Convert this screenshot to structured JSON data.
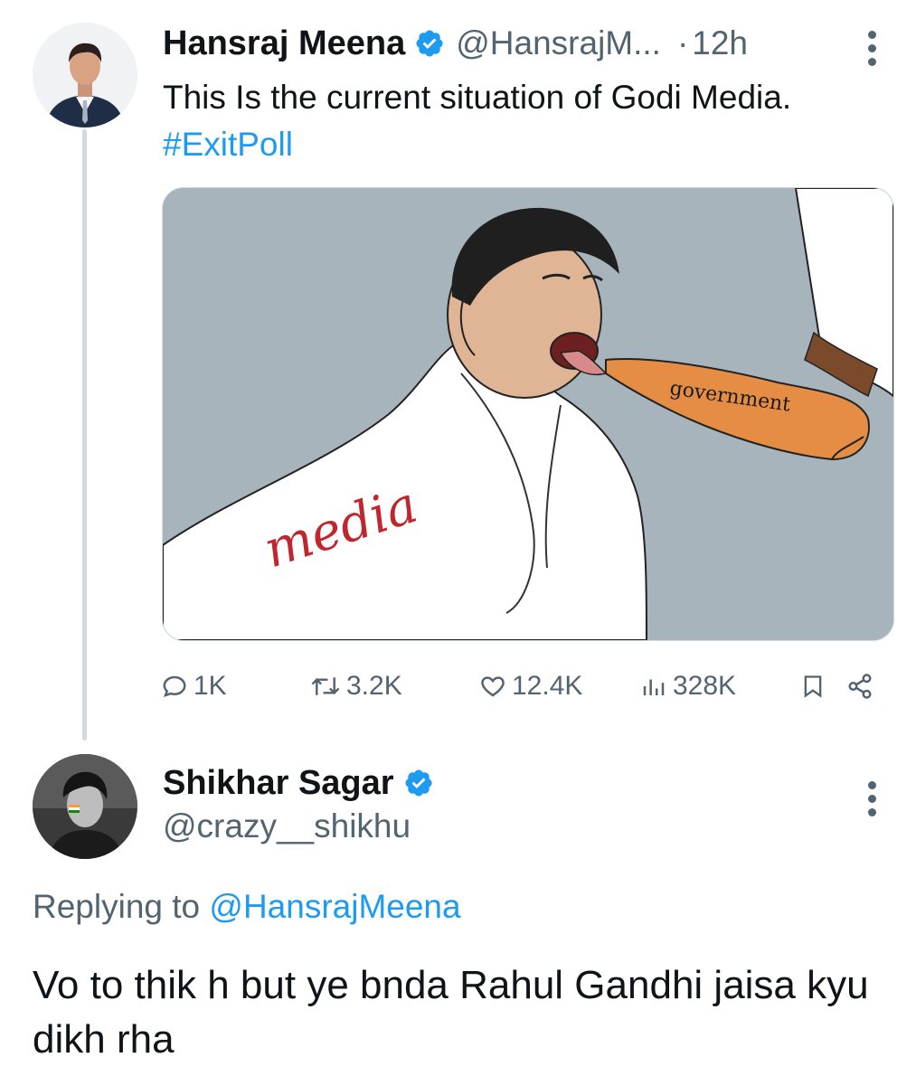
{
  "tweet": {
    "author": {
      "name": "Hansraj Meena",
      "handle": "@HansrajM...",
      "verified": true
    },
    "dot": "·",
    "time": "12h",
    "text_before": "This Is the current situation of Godi Media. ",
    "hashtag": "#ExitPoll",
    "image": {
      "labels": {
        "figure_text": "media",
        "shoe_text": "government"
      }
    },
    "actions": {
      "replies": "1K",
      "retweets": "3.2K",
      "likes": "12.4K",
      "views": "328K"
    }
  },
  "reply": {
    "author": {
      "name": "Shikhar Sagar",
      "handle": "@crazy__shikhu",
      "verified": true
    },
    "replying_prefix": "Replying to ",
    "replying_to": "@HansrajMeena",
    "text": "Vo to thik h but ye bnda Rahul Gandhi jaisa kyu dikh rha"
  },
  "colors": {
    "accent": "#1d9bf0",
    "secondary_text": "#536471",
    "primary_text": "#0f1419"
  },
  "icons": [
    "verified-badge-icon",
    "more-icon",
    "reply-icon",
    "retweet-icon",
    "like-icon",
    "views-icon",
    "bookmark-icon",
    "share-icon"
  ]
}
